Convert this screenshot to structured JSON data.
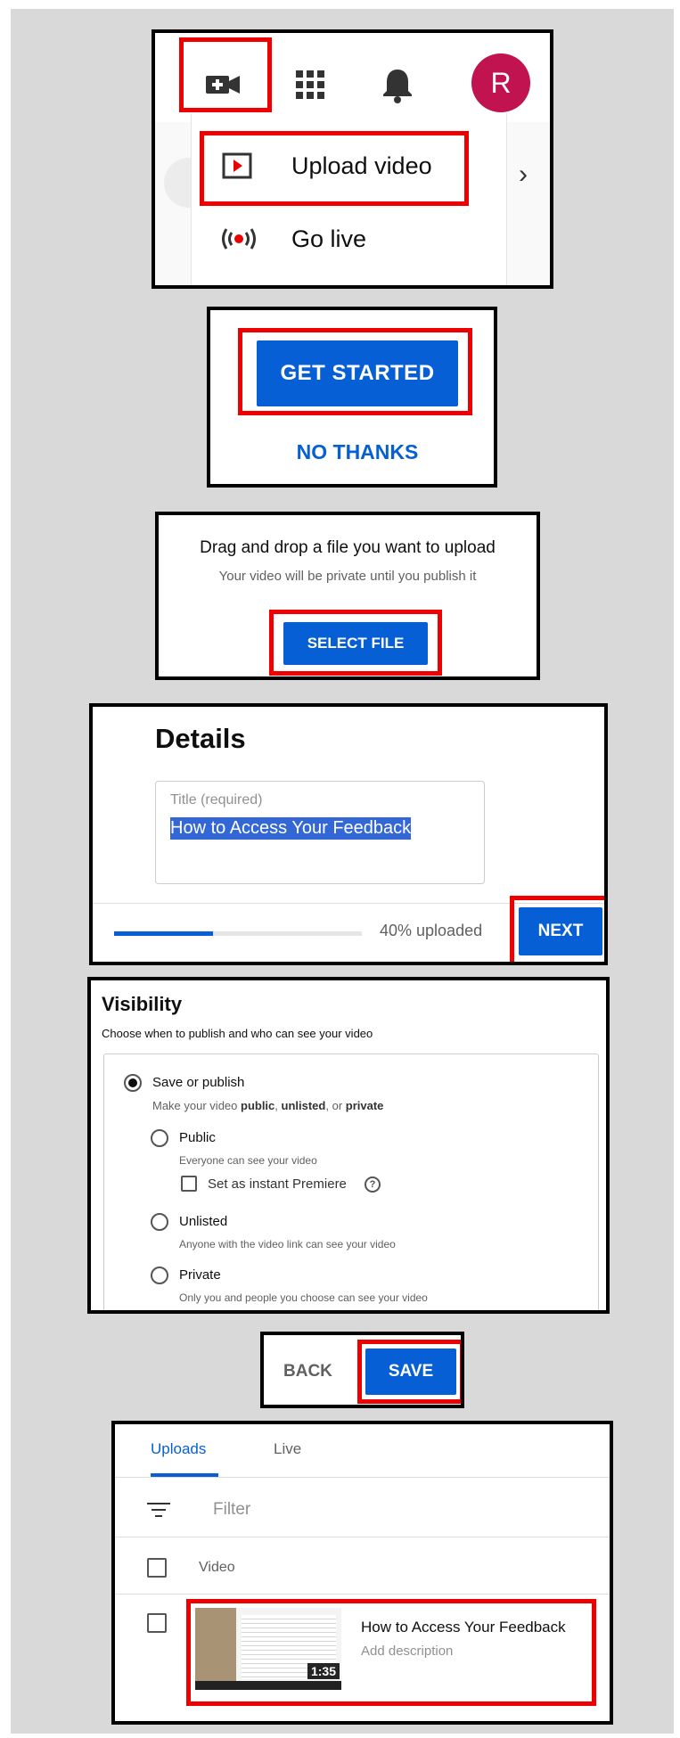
{
  "panel1": {
    "avatar_letter": "R",
    "menu": {
      "upload_label": "Upload video",
      "golive_label": "Go live",
      "chevron": "›"
    },
    "icons": {
      "create": "video-camera-plus-icon",
      "apps": "apps-grid-icon",
      "notifications": "bell-icon",
      "upload": "play-square-icon",
      "live": "broadcast-icon"
    },
    "colors": {
      "avatar": "#c0134f",
      "live_red": "#ff0000"
    }
  },
  "panel2": {
    "get_started": "GET STARTED",
    "no_thanks": "NO THANKS"
  },
  "panel3": {
    "heading": "Drag and drop a file you want to upload",
    "subtext": "Your video will be private until you publish it",
    "select_file": "SELECT FILE"
  },
  "panel4": {
    "heading": "Details",
    "title_label": "Title (required)",
    "title_value": "How to Access Your Feedback",
    "upload_status": "40% uploaded",
    "upload_progress": 0.4,
    "next": "NEXT"
  },
  "panel5": {
    "heading": "Visibility",
    "subheading": "Choose when to publish and who can see your video",
    "save_publish": {
      "label": "Save or publish",
      "desc_prefix": "Make your video ",
      "desc_public": "public",
      "desc_sep": ", ",
      "desc_unlisted": "unlisted",
      "desc_or": ", or ",
      "desc_private": "private",
      "selected": true
    },
    "options": [
      {
        "label": "Public",
        "desc": "Everyone can see your video"
      },
      {
        "label": "Unlisted",
        "desc": "Anyone with the video link can see your video"
      },
      {
        "label": "Private",
        "desc": "Only you and people you choose can see your video"
      }
    ],
    "premiere_label": "Set as instant Premiere",
    "help_icon": "?"
  },
  "panel6": {
    "back": "BACK",
    "save": "SAVE"
  },
  "panel7": {
    "tabs": [
      {
        "label": "Uploads",
        "active": true
      },
      {
        "label": "Live",
        "active": false
      }
    ],
    "filter_placeholder": "Filter",
    "column_video": "Video",
    "video": {
      "title": "How to Access Your Feedback",
      "description": "Add description",
      "duration": "1:35"
    }
  }
}
